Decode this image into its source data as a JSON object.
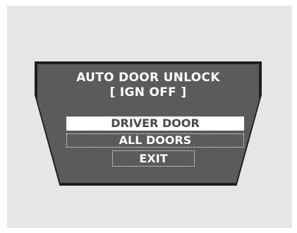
{
  "display": {
    "title_line1": "AUTO DOOR UNLOCK",
    "title_line2": "[ IGN OFF ]",
    "options": [
      {
        "label": "DRIVER DOOR",
        "selected": true
      },
      {
        "label": "ALL DOORS",
        "selected": false
      },
      {
        "label": "EXIT",
        "selected": false
      }
    ]
  },
  "colors": {
    "screen_bg": "#5b5b5b",
    "screen_border": "#1e1e1e",
    "panel_bg": "#e6e6e6",
    "highlight_bg": "#ffffff",
    "highlight_text": "#4a4a4a",
    "text": "#ffffff"
  }
}
